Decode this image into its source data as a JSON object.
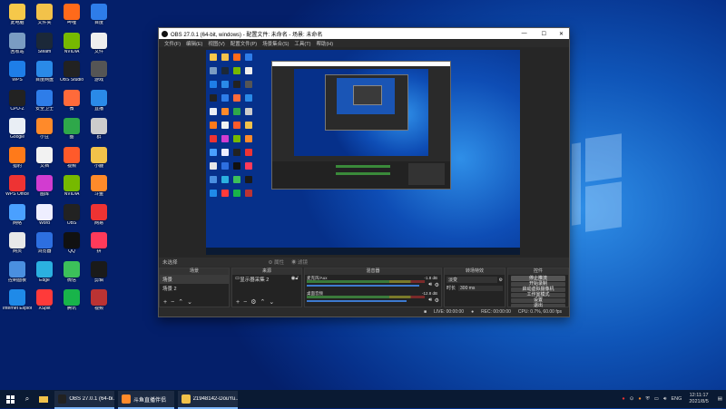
{
  "desktop": {
    "icons": [
      {
        "label": "此电脑",
        "color": "#f6c84a"
      },
      {
        "label": "回收站",
        "color": "#7a9cc2"
      },
      {
        "label": "WPS",
        "color": "#1e7ee8"
      },
      {
        "label": "CPU-Z",
        "color": "#222"
      },
      {
        "label": "Google",
        "color": "#e9eef5"
      },
      {
        "label": "猎豹",
        "color": "#ff7a1a"
      },
      {
        "label": "WPS Office",
        "color": "#e33"
      },
      {
        "label": "网络",
        "color": "#4aa0ff"
      },
      {
        "label": "网页",
        "color": "#e8e8e8"
      },
      {
        "label": "控制面板",
        "color": "#4a8fe0"
      },
      {
        "label": "Internet Explorer",
        "color": "#1f8ae8"
      },
      {
        "label": "文件夹",
        "color": "#f2c24a"
      },
      {
        "label": "Steam",
        "color": "#1b2838"
      },
      {
        "label": "百度网盘",
        "color": "#2a8ae8"
      },
      {
        "label": "安全卫士",
        "color": "#2e7de9"
      },
      {
        "label": "小豆",
        "color": "#ff8a2a"
      },
      {
        "label": "文档",
        "color": "#f2f2f2"
      },
      {
        "label": "图库",
        "color": "#d23cd0"
      },
      {
        "label": "Word",
        "color": "#eef"
      },
      {
        "label": "浏览器",
        "color": "#2d6fe0"
      },
      {
        "label": "Edge",
        "color": "#2bb0e0"
      },
      {
        "label": "XSplit",
        "color": "#ff3a3a"
      },
      {
        "label": "哔哩",
        "color": "#ff6a1a"
      },
      {
        "label": "NVIDIA",
        "color": "#76b900"
      },
      {
        "label": "OBS Studio",
        "color": "#222"
      },
      {
        "label": "微",
        "color": "#ff6a3a"
      },
      {
        "label": "图",
        "color": "#2ea84a"
      },
      {
        "label": "视频",
        "color": "#ff5a2a"
      },
      {
        "label": "NVIDIA",
        "color": "#76b900"
      },
      {
        "label": "OBS",
        "color": "#222"
      },
      {
        "label": "QQ",
        "color": "#111"
      },
      {
        "label": "微信",
        "color": "#3cc05a"
      },
      {
        "label": "腾讯",
        "color": "#18b44a"
      },
      {
        "label": "百度",
        "color": "#2e7de9"
      },
      {
        "label": "文件",
        "color": "#eee"
      },
      {
        "label": "游戏",
        "color": "#555"
      },
      {
        "label": "直播",
        "color": "#2a8ae8"
      },
      {
        "label": "群",
        "color": "#ccc"
      },
      {
        "label": "小鹿",
        "color": "#f2c24a"
      },
      {
        "label": "斗鱼",
        "color": "#ff8a2a"
      },
      {
        "label": "网易",
        "color": "#e33"
      },
      {
        "label": "拼",
        "color": "#ff3a5a"
      },
      {
        "label": "剪辑",
        "color": "#1a1a1a"
      },
      {
        "label": "视频",
        "color": "#bb3333"
      }
    ]
  },
  "obs": {
    "title": "OBS 27.0.1 (64-bit, windows) - 配置文件: 未命名 - 场景: 未命名",
    "menus": [
      "文件(F)",
      "编辑(E)",
      "视图(V)",
      "配置文件(P)",
      "场景集合(S)",
      "工具(T)",
      "帮助(H)"
    ],
    "source_bar": "未选择",
    "source_props": "属性",
    "source_filters": "滤镜",
    "docks": {
      "scenes": {
        "title": "场景",
        "items": [
          "场景",
          "场景 2"
        ]
      },
      "sources": {
        "title": "来源",
        "items": [
          "显示器采集 2"
        ]
      },
      "mixer": {
        "title": "混音器",
        "channels": [
          {
            "name": "麦克风/Aux",
            "db": "-1.8 dB"
          },
          {
            "name": "桌面音频",
            "db": "-12.8 dB"
          }
        ]
      },
      "transitions": {
        "title": "转场特效",
        "type": "淡变",
        "duration_label": "时长",
        "duration": "300 ms"
      },
      "controls": {
        "title": "控件",
        "buttons": [
          "停止推流",
          "开始录制",
          "启动虚拟摄像机",
          "工作室模式",
          "设置",
          "退出"
        ]
      }
    },
    "status": {
      "live": "LIVE: 00:00:00",
      "rec": "REC: 00:00:00",
      "cpu": "CPU: 0.7%, 60.00 fps"
    }
  },
  "taskbar": {
    "apps": [
      {
        "label": "OBS 27.0.1 (64-bi...",
        "color": "#222"
      },
      {
        "label": "斗鱼直播伴侣",
        "color": "#ff8a2a"
      },
      {
        "label": "21948142-DouYu...",
        "color": "#f2c24a"
      }
    ],
    "time": "12:11:17",
    "date": "2021/8/5",
    "lang": "ENG"
  },
  "colors": {
    "accent": "#1e6fe0",
    "taskbar": "#0a1a33",
    "obs_bg": "#2b2b2b"
  }
}
